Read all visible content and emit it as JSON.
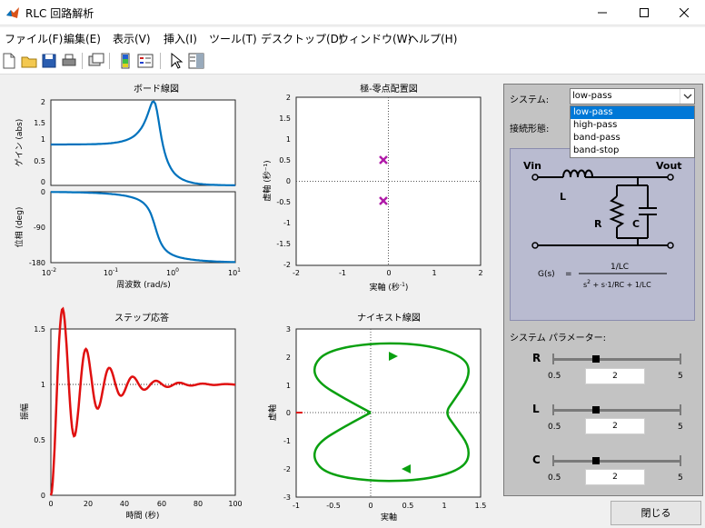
{
  "window": {
    "title": "RLC 回路解析"
  },
  "menu": [
    "ファイル(F)",
    "編集(E)",
    "表示(V)",
    "挿入(I)",
    "ツール(T)",
    "デスクトップ(D)",
    "ウィンドウ(W)",
    "ヘルプ(H)"
  ],
  "plots": {
    "bode": {
      "title": "ボード線図",
      "mag_ylabel": "ゲイン (abs)",
      "phase_ylabel": "位相 (deg)",
      "xlabel": "周波数 (rad/s)",
      "mag_yticks": [
        "0",
        "0.5",
        "1",
        "1.5",
        "2"
      ],
      "phase_yticks": [
        "0",
        "-90",
        "-180"
      ],
      "xticks": [
        "10",
        "10",
        "10",
        "10"
      ],
      "xtick_exps": [
        "-2",
        "-1",
        "0",
        "1"
      ]
    },
    "pz": {
      "title": "極-零点配置図",
      "xlabel": "実軸 (秒",
      "xlabel_sup": "-1",
      "xlabel_end": ")",
      "ylabel": "虚軸 (秒⁻¹)",
      "xticks": [
        "-2",
        "-1",
        "0",
        "1",
        "2"
      ],
      "yticks": [
        "2",
        "1.5",
        "1",
        "0.5",
        "0",
        "-0.5",
        "-1",
        "-1.5",
        "-2"
      ]
    },
    "step": {
      "title": "ステップ応答",
      "xlabel": "時間 (秒)",
      "ylabel": "振幅",
      "xticks": [
        "0",
        "20",
        "40",
        "60",
        "80",
        "100"
      ],
      "yticks": [
        "0",
        "0.5",
        "1",
        "1.5"
      ]
    },
    "nyquist": {
      "title": "ナイキスト線図",
      "xlabel": "実軸",
      "ylabel": "虚軸",
      "xticks": [
        "-1",
        "-0.5",
        "0",
        "0.5",
        "1",
        "1.5"
      ],
      "yticks": [
        "3",
        "2",
        "1",
        "0",
        "-1",
        "-2",
        "-3"
      ]
    }
  },
  "panel": {
    "system_label": "システム:",
    "system_value": "low-pass",
    "system_options": [
      "low-pass",
      "high-pass",
      "band-pass",
      "band-stop"
    ],
    "connection_label": "接続形態:",
    "circuit": {
      "vin": "Vin",
      "vout": "Vout",
      "L": "L",
      "R": "R",
      "C": "C",
      "formula_lhs": "G(s)",
      "formula_eq": "=",
      "numerator": "1/LC",
      "denominator_a": "s",
      "denominator_exp": "2",
      "denominator_b": " + s·1/RC + 1/LC"
    },
    "params_label": "システム パラメーター:",
    "sliders": [
      {
        "name": "R",
        "min": "0.5",
        "max": "5",
        "value": "2",
        "fraction": 0.33
      },
      {
        "name": "L",
        "min": "0.5",
        "max": "5",
        "value": "2",
        "fraction": 0.33
      },
      {
        "name": "C",
        "min": "0.5",
        "max": "5",
        "value": "2",
        "fraction": 0.33
      }
    ]
  },
  "close_button": "閉じる",
  "colors": {
    "bode": "#0072bd",
    "pz": "#b01aa8",
    "step": "#e01010",
    "nyquist": "#0aa010"
  }
}
